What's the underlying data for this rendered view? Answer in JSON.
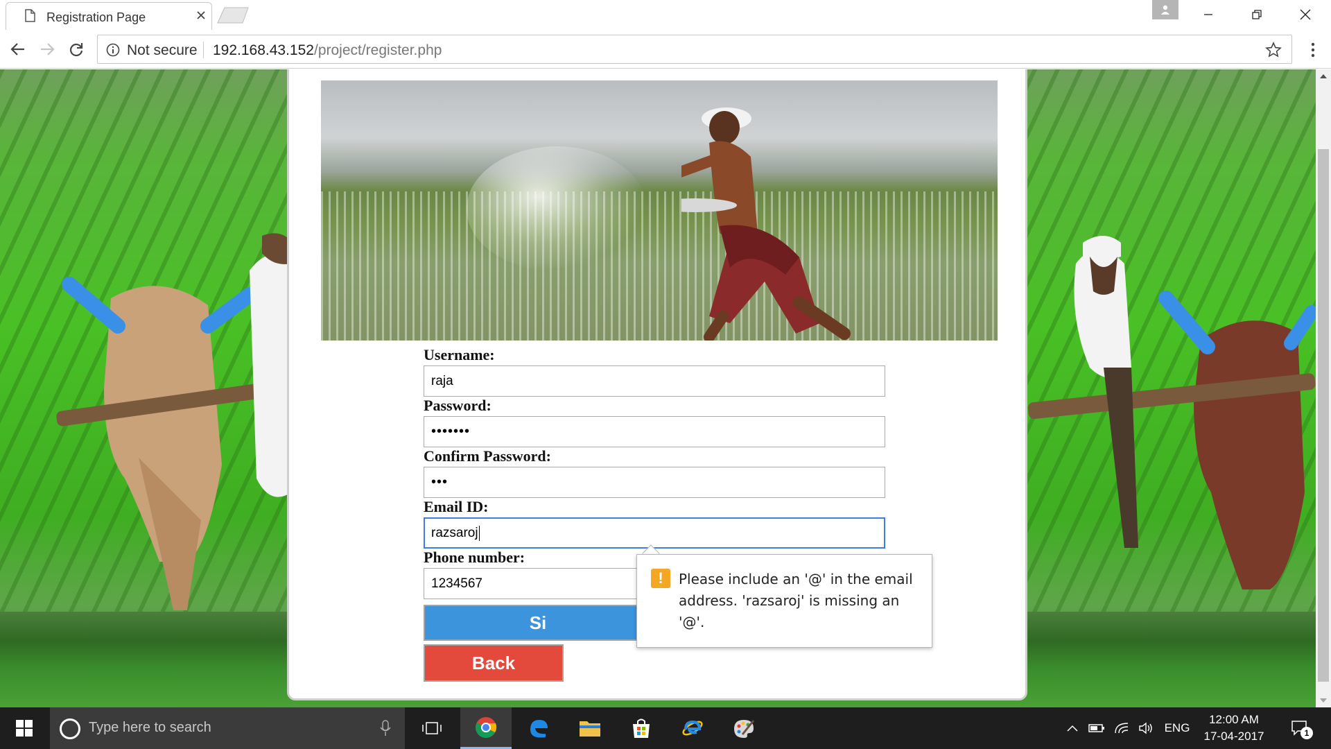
{
  "browser": {
    "tab_title": "Registration Page",
    "security_label": "Not secure",
    "url_host": "192.168.43.152",
    "url_path": "/project/register.php"
  },
  "form": {
    "username_label": "Username:",
    "username_value": "raja",
    "password_label": "Password:",
    "password_value": "•••••••",
    "confirm_label": "Confirm Password:",
    "confirm_value": "•••",
    "email_label": "Email ID:",
    "email_value": "razsaroj",
    "phone_label": "Phone number:",
    "phone_value": "1234567",
    "signup_label": "Si",
    "back_label": "Back"
  },
  "validation": {
    "message": "Please include an '@' in the email address. 'razsaroj' is missing an '@'."
  },
  "taskbar": {
    "search_placeholder": "Type here to search",
    "language": "ENG",
    "time": "12:00 AM",
    "date": "17-04-2017",
    "notification_count": "1"
  },
  "colors": {
    "signup_button": "#3b94dc",
    "back_button": "#e34a3b",
    "focus_border": "#3b7fe0",
    "warning": "#f5a623"
  }
}
